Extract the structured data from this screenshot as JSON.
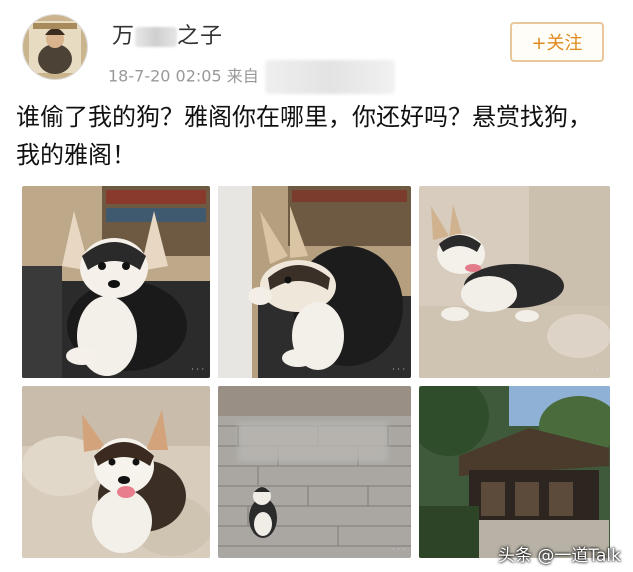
{
  "post": {
    "author": {
      "name_start": "万",
      "name_end": "之子"
    },
    "time": "18-7-20 02:05",
    "source_prefix": "来自",
    "follow_label": "+关注",
    "text": "谁偷了我的狗？雅阁你在哪里，你还好吗？悬赏找狗，我的雅阁！"
  },
  "watermark": "头条 @一道Talk",
  "photos": [
    {
      "subject": "corgi-on-couch"
    },
    {
      "subject": "corgi-profile"
    },
    {
      "subject": "corgi-lying-couch"
    },
    {
      "subject": "corgi-puppy-cushion"
    },
    {
      "subject": "corgi-on-pavement"
    },
    {
      "subject": "building-trees"
    }
  ]
}
